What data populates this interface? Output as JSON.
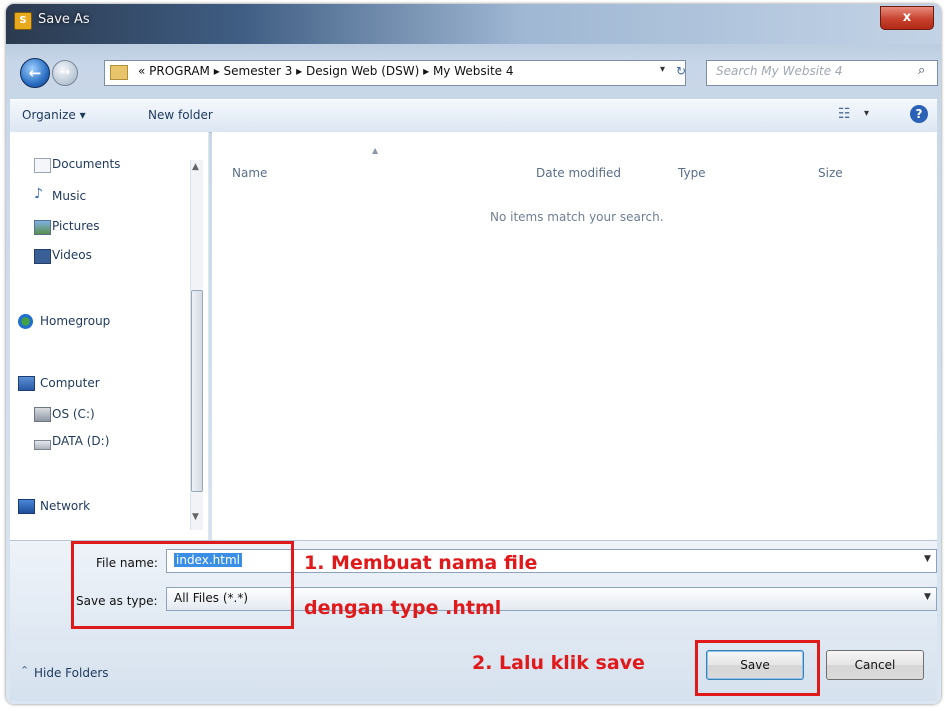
{
  "window": {
    "title": "Save As",
    "close_glyph": "x"
  },
  "nav": {
    "back_glyph": "←",
    "forward_glyph": "→",
    "address_path": "« PROGRAM ▸ Semester 3 ▸ Design Web (DSW) ▸ My Website 4",
    "search_placeholder": "Search My Website 4",
    "search_icon": "search-icon"
  },
  "toolbar": {
    "organize_label": "Organize ▾",
    "new_folder_label": "New folder",
    "help_glyph": "?"
  },
  "navpane": {
    "items": [
      {
        "label": "Documents",
        "icon": "documents-icon"
      },
      {
        "label": "Music",
        "icon": "music-icon"
      },
      {
        "label": "Pictures",
        "icon": "pictures-icon"
      },
      {
        "label": "Videos",
        "icon": "videos-icon"
      },
      {
        "label": "Homegroup",
        "icon": "homegroup-icon"
      },
      {
        "label": "Computer",
        "icon": "computer-icon"
      },
      {
        "label": "OS (C:)",
        "icon": "drive-icon"
      },
      {
        "label": "DATA (D:)",
        "icon": "drive-icon"
      },
      {
        "label": "Network",
        "icon": "network-icon"
      }
    ]
  },
  "filelist": {
    "columns": [
      "Name",
      "Date modified",
      "Type",
      "Size"
    ],
    "empty_message": "No items match your search."
  },
  "form": {
    "file_name_label": "File name:",
    "file_name_value": "index.html",
    "save_type_label": "Save as type:",
    "save_type_value": "All Files (*.*)"
  },
  "footer": {
    "hide_folders_label": "Hide Folders",
    "save_label": "Save",
    "cancel_label": "Cancel"
  },
  "annotations": {
    "step1_line1": "1. Membuat nama file",
    "step1_line2": "dengan type .html",
    "step2": "2. Lalu klik save",
    "color": "#e0191b"
  }
}
